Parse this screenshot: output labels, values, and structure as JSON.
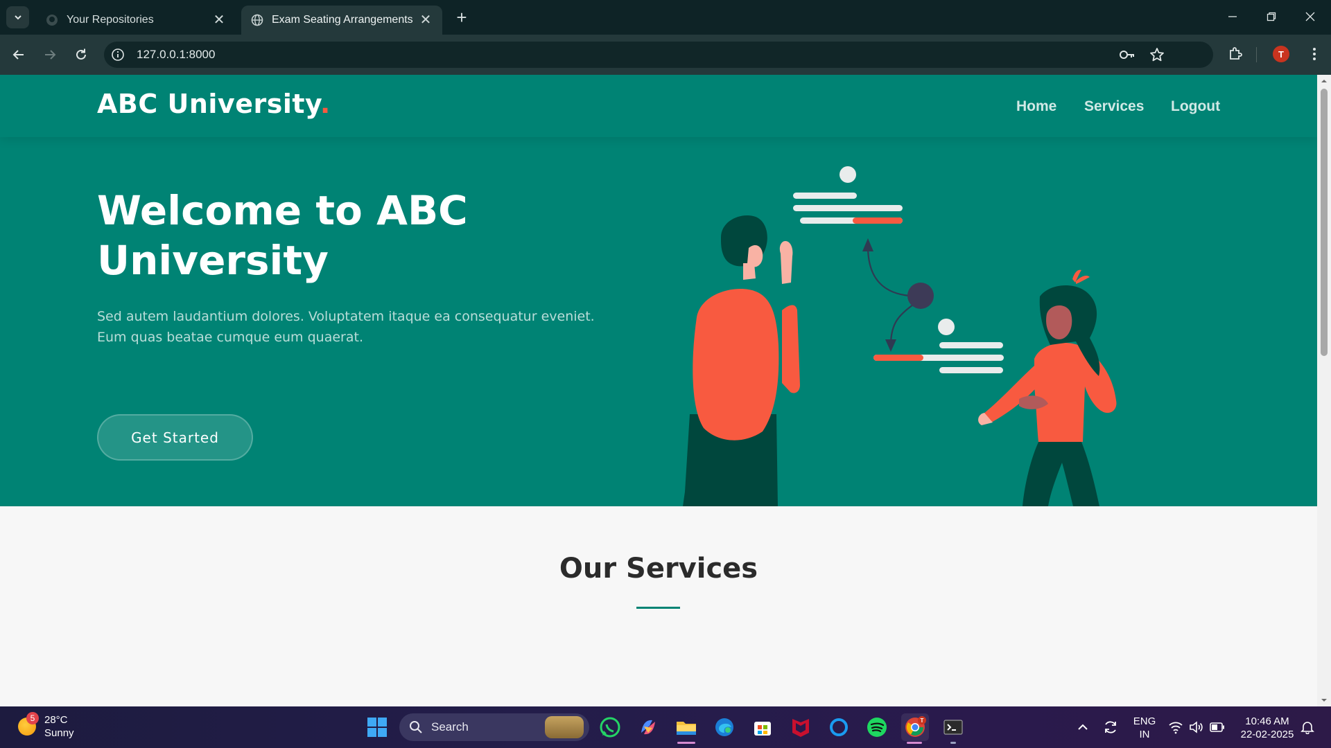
{
  "browser": {
    "tabs": [
      {
        "label": "Your Repositories",
        "active": false,
        "icon": "github-icon"
      },
      {
        "label": "Exam Seating Arrangements",
        "active": true,
        "icon": "globe-icon"
      }
    ],
    "new_tab": "+",
    "close_symbol": "✕",
    "url": "127.0.0.1:8000",
    "profile_initial": "T"
  },
  "site": {
    "logo": "ABC University",
    "logo_dot": ".",
    "nav": [
      "Home",
      "Services",
      "Logout"
    ],
    "hero": {
      "title": "Welcome to ABC University",
      "text": "Sed autem laudantium dolores. Voluptatem itaque ea consequatur eveniet. Eum quas beatae cumque eum quaerat.",
      "cta": "Get Started"
    },
    "services_title": "Our Services"
  },
  "colors": {
    "brand": "#008374",
    "accent": "#f85a40",
    "dark_green": "#00473d"
  },
  "taskbar": {
    "weather": {
      "temp": "28°C",
      "condition": "Sunny",
      "badge": "5"
    },
    "search_label": "Search",
    "apps": [
      "start-icon",
      "whatsapp-icon",
      "copilot-icon",
      "file-explorer-icon",
      "edge-icon",
      "store-icon",
      "mcafee-icon",
      "cortana-icon",
      "spotify-icon",
      "chrome-icon",
      "terminal-icon"
    ],
    "lang": {
      "line1": "ENG",
      "line2": "IN"
    },
    "clock": {
      "time": "10:46 AM",
      "date": "22-02-2025"
    }
  }
}
